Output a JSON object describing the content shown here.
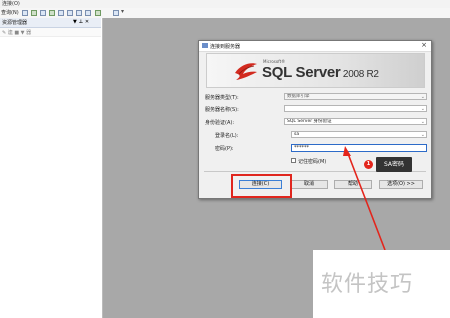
{
  "app": {
    "menu_items": [
      "连接(O)",
      "查询(N)"
    ],
    "toolbar_label": "查询(N)"
  },
  "left_panel": {
    "title": "资源管理器",
    "pin": "▼ ⊥ ✕",
    "tools": "✎ 連 ■ ▼ 器"
  },
  "dialog": {
    "title": "连接到服务器",
    "close": "×",
    "brand_small": "Microsoft®",
    "product_main": "SQL Server",
    "product_version": " 2008 R2",
    "fields": {
      "server_type_label": "服务器类型(T):",
      "server_type_value": "数据库引擎",
      "server_name_label": "服务器名称(S):",
      "server_name_value": "",
      "auth_label": "身份验证(A):",
      "auth_value": "SQL Server 身份验证",
      "login_label": "登录名(L):",
      "login_value": "sa",
      "password_label": "密码(P):",
      "password_value": "******",
      "remember_label": "记住密码(M)"
    },
    "buttons": {
      "connect": "连接(C)",
      "cancel": "取消",
      "help": "帮助",
      "options": "选项(O) >>"
    }
  },
  "annotation": {
    "badge": "1",
    "text": "SA密码",
    "accent": "#e3251c"
  },
  "watermark": {
    "text": "软件技巧"
  }
}
